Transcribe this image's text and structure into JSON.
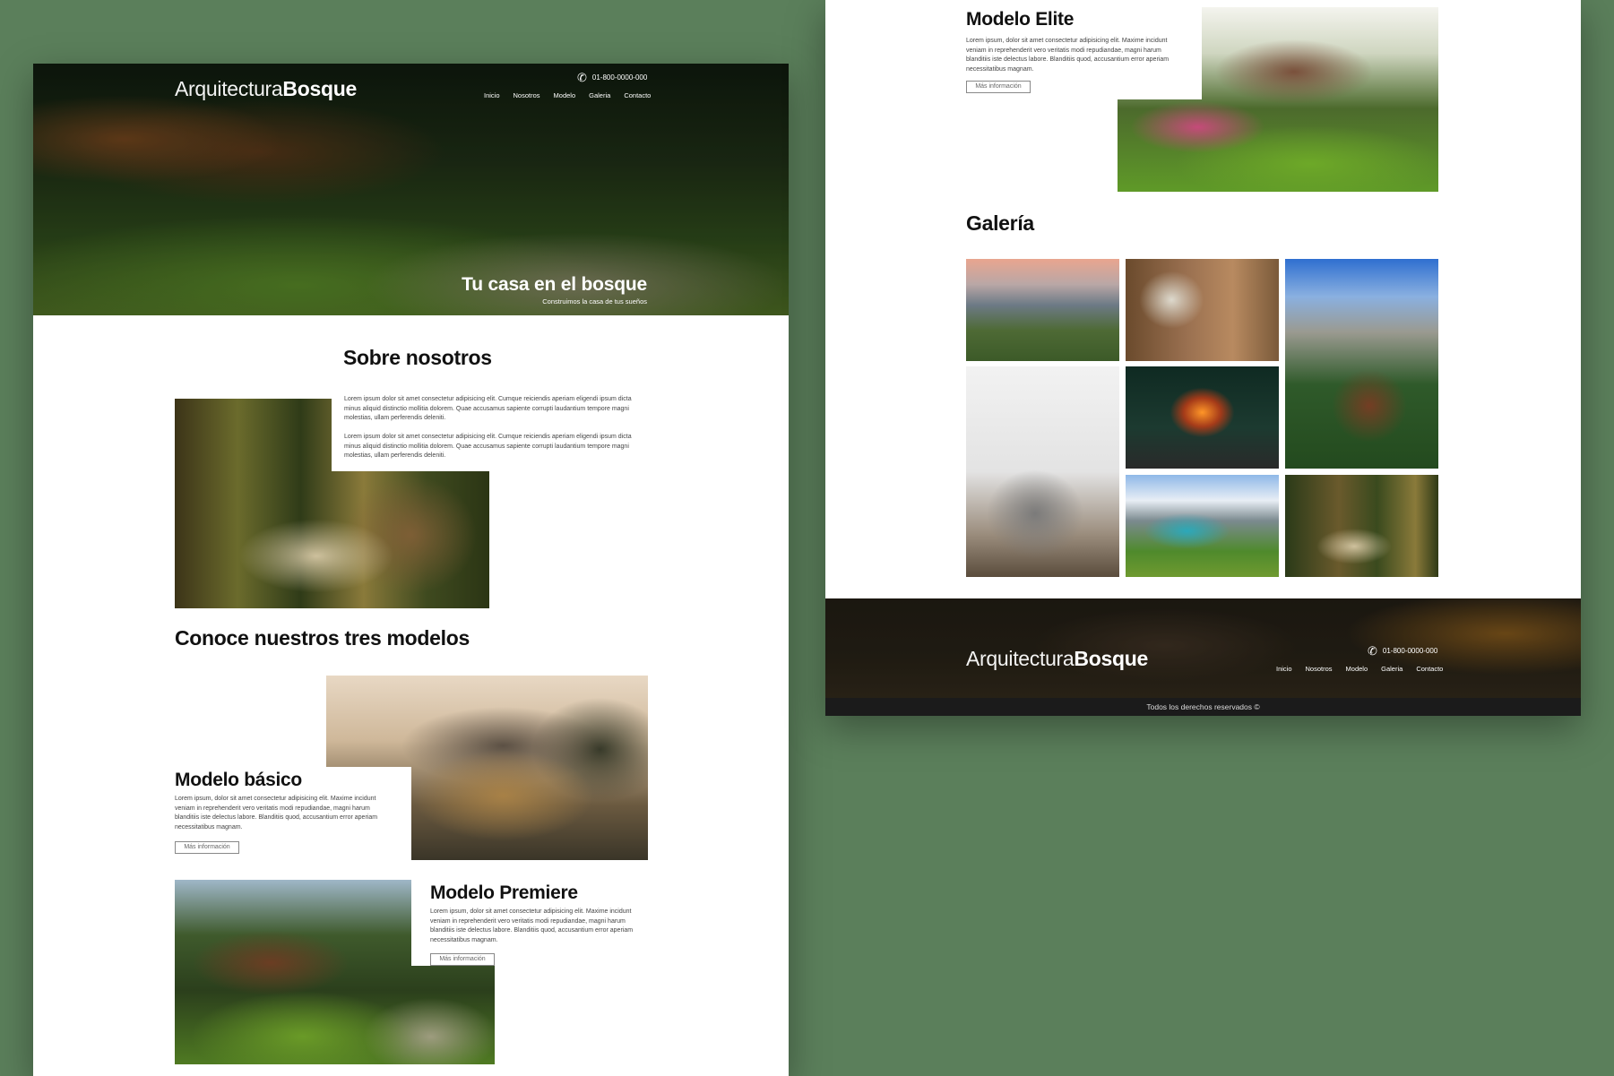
{
  "brand": {
    "name_light": "Arquitectura",
    "name_bold": "Bosque"
  },
  "contact": {
    "phone": "01-800-0000-000"
  },
  "nav": [
    "Inicio",
    "Nosotros",
    "Modelo",
    "Galeria",
    "Contacto"
  ],
  "hero": {
    "title": "Tu casa en el bosque",
    "subtitle": "Construimos la casa de tus sueños"
  },
  "about": {
    "title": "Sobre nosotros",
    "paragraphs": [
      "Lorem ipsum dolor sit amet consectetur adipisicing elit. Cumque reiciendis aperiam eligendi ipsum dicta minus aliquid distinctio mollitia dolorem. Quae accusamus sapiente corrupti laudantium tempore magni molestias, ullam perferendis deleniti.",
      "Lorem ipsum dolor sit amet consectetur adipisicing elit. Cumque reiciendis aperiam eligendi ipsum dicta minus aliquid distinctio mollitia dolorem. Quae accusamus sapiente corrupti laudantium tempore magni molestias, ullam perferendis deleniti."
    ]
  },
  "models": {
    "title": "Conoce nuestros tres modelos",
    "items": [
      {
        "name": "Modelo básico",
        "text": "Lorem ipsum, dolor sit amet consectetur adipisicing elit. Maxime incidunt veniam in reprehenderit vero veritatis modi repudiandae, magni harum blanditiis iste delectus labore. Blanditiis quod, accusantium error aperiam necessitatibus magnam.",
        "button": "Más información"
      },
      {
        "name": "Modelo Premiere",
        "text": "Lorem ipsum, dolor sit amet consectetur adipisicing elit. Maxime incidunt veniam in reprehenderit vero veritatis modi repudiandae, magni harum blanditiis iste delectus labore. Blanditiis quod, accusantium error aperiam necessitatibus magnam.",
        "button": "Más información"
      },
      {
        "name": "Modelo Elite",
        "text": "Lorem ipsum, dolor sit amet consectetur adipisicing elit. Maxime incidunt veniam in reprehenderit vero veritatis modi repudiandae, magni harum blanditiis iste delectus labore. Blanditiis quod, accusantium error aperiam necessitatibus magnam.",
        "button": "Más información"
      }
    ]
  },
  "gallery": {
    "title": "Galería"
  },
  "footer": {
    "copyright": "Todos los derechos reservados ©"
  },
  "icons": {
    "phone": "phone-icon"
  },
  "colors": {
    "background": "#5b7f5b",
    "footer_bar": "#1b1b1b",
    "text": "#111111"
  }
}
